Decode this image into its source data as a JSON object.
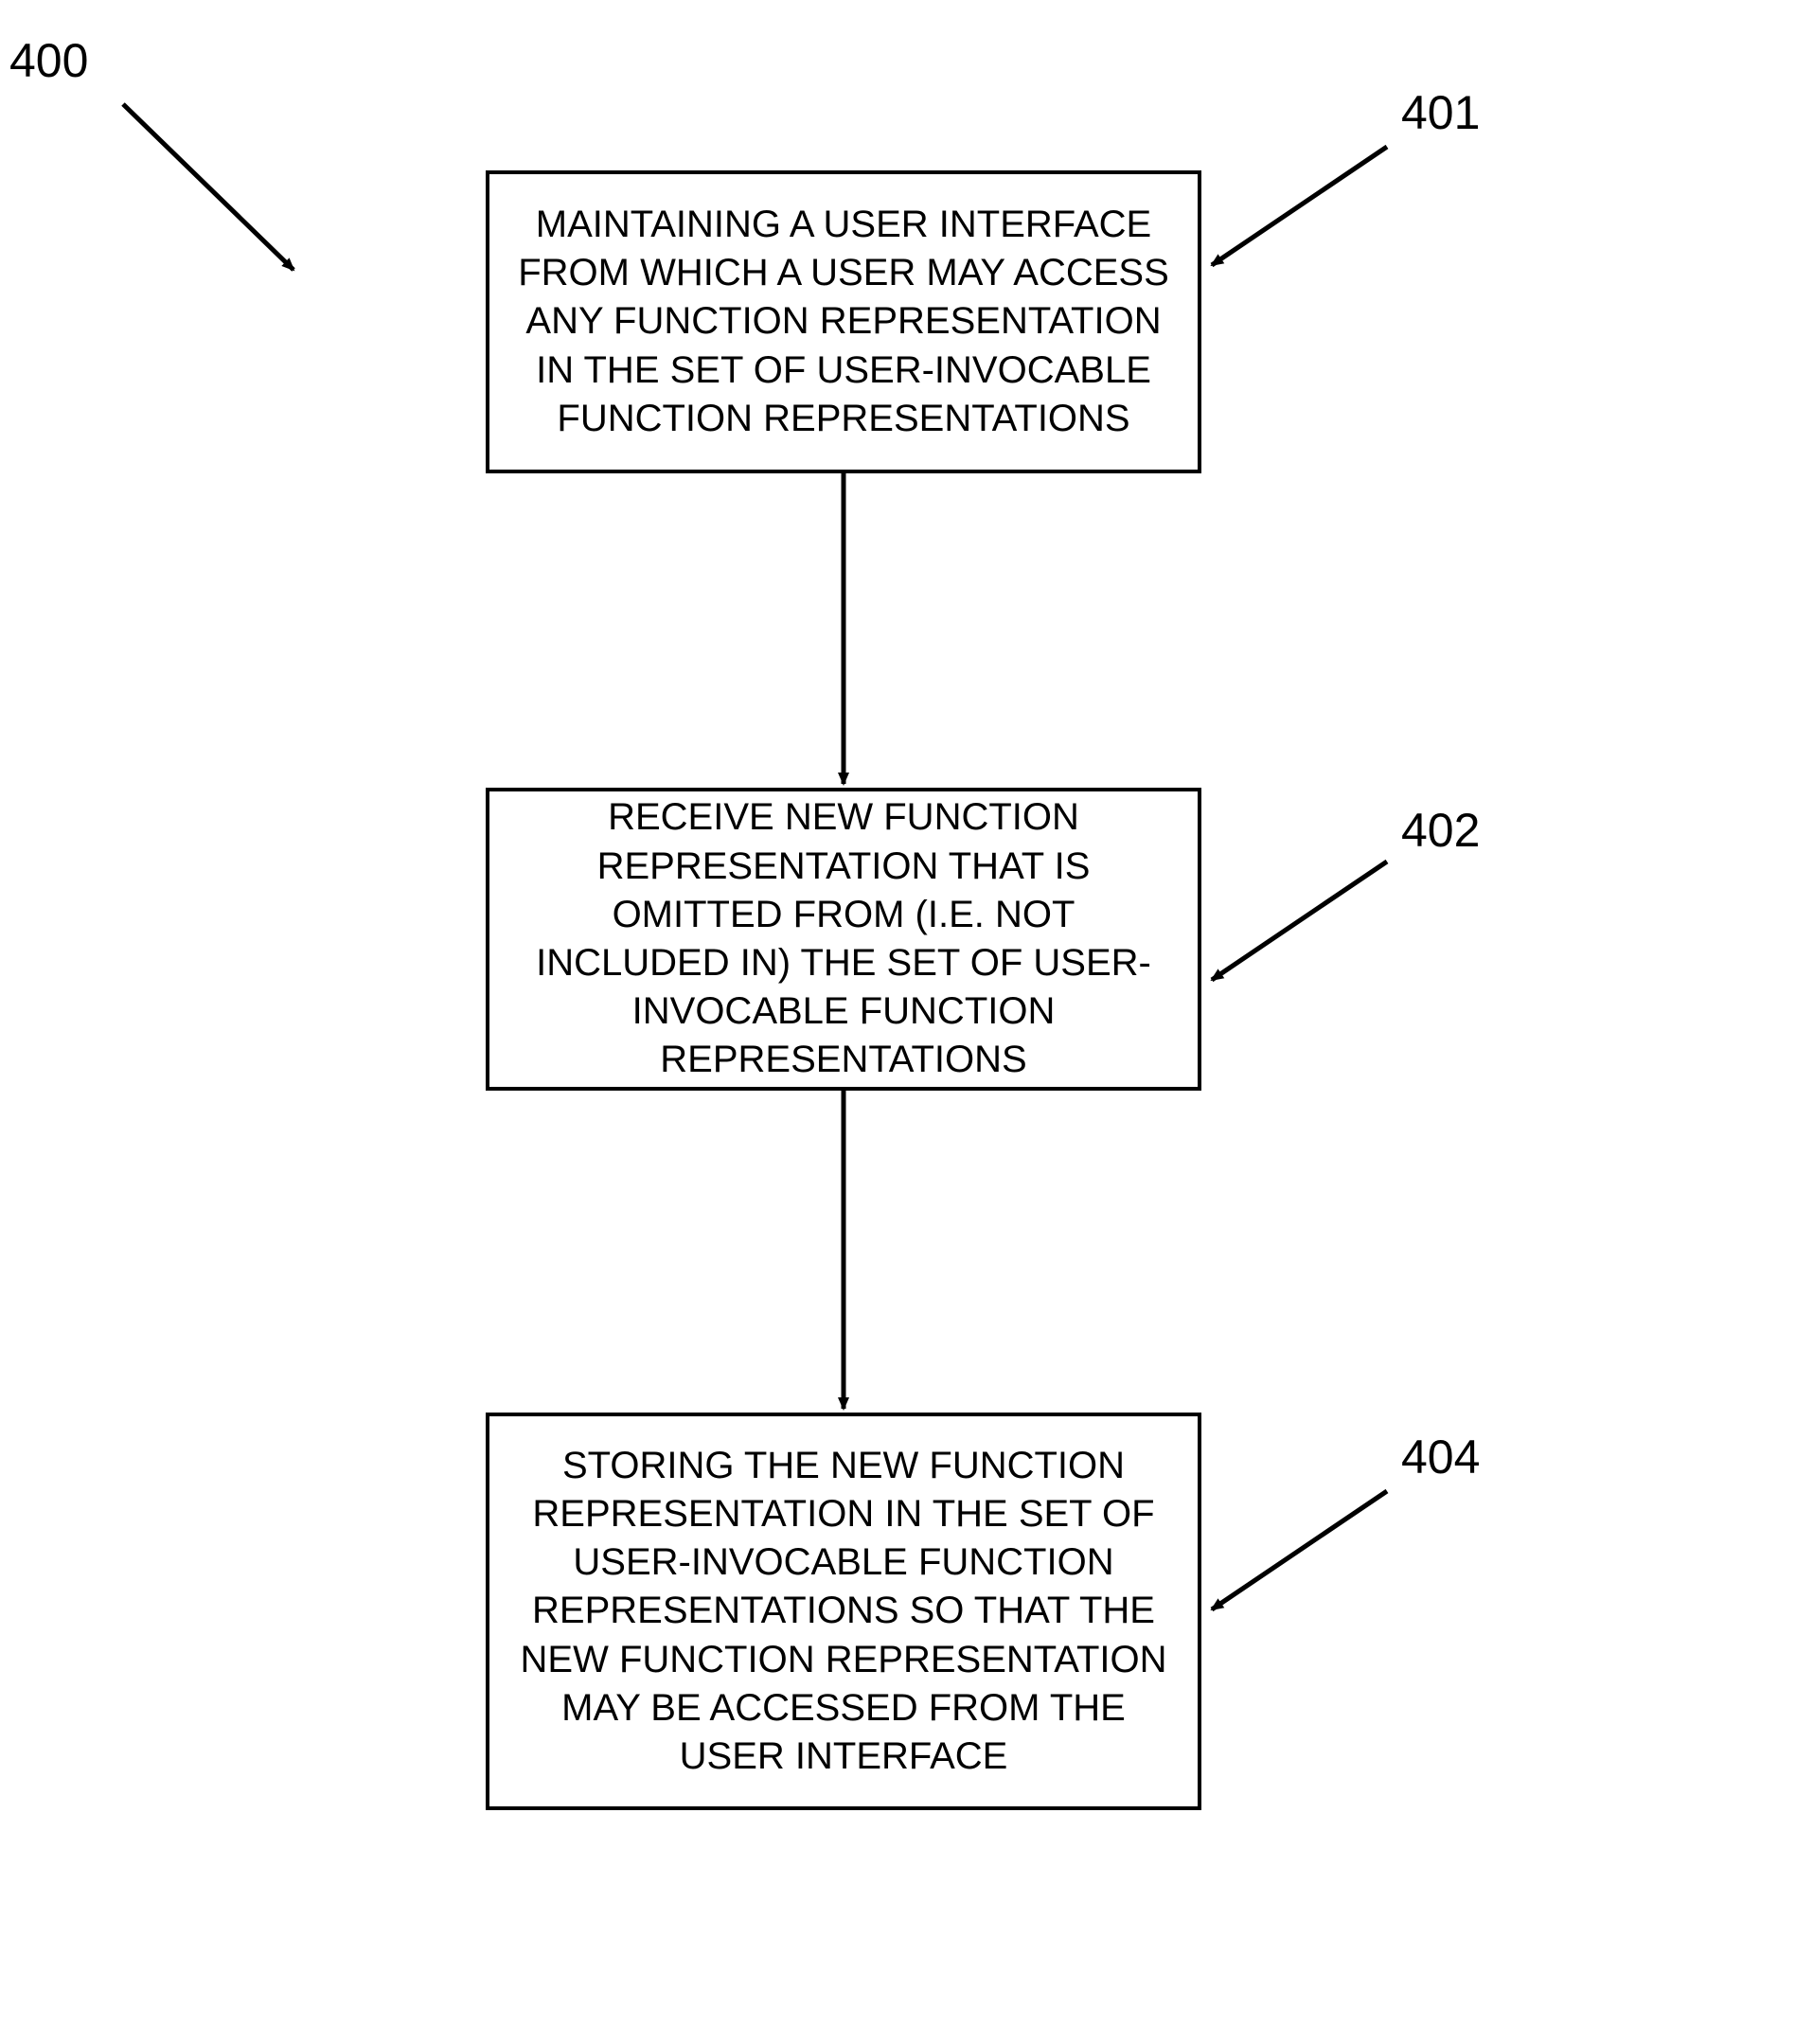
{
  "diagram": {
    "overall_label": "400",
    "steps": [
      {
        "id": "step1",
        "label": "401",
        "text": "MAINTAINING A USER INTERFACE FROM WHICH A USER MAY ACCESS ANY FUNCTION REPRESENTATION IN THE SET OF USER-INVOCABLE FUNCTION REPRESENTATIONS"
      },
      {
        "id": "step2",
        "label": "402",
        "text": "RECEIVE NEW FUNCTION REPRESENTATION THAT IS OMITTED FROM (I.E. NOT INCLUDED IN) THE SET OF USER-INVOCABLE FUNCTION REPRESENTATIONS"
      },
      {
        "id": "step3",
        "label": "404",
        "text": "STORING THE NEW FUNCTION REPRESENTATION IN THE SET OF USER-INVOCABLE FUNCTION REPRESENTATIONS SO THAT THE NEW FUNCTION REPRESENTATION MAY BE ACCESSED FROM THE USER INTERFACE"
      }
    ]
  }
}
